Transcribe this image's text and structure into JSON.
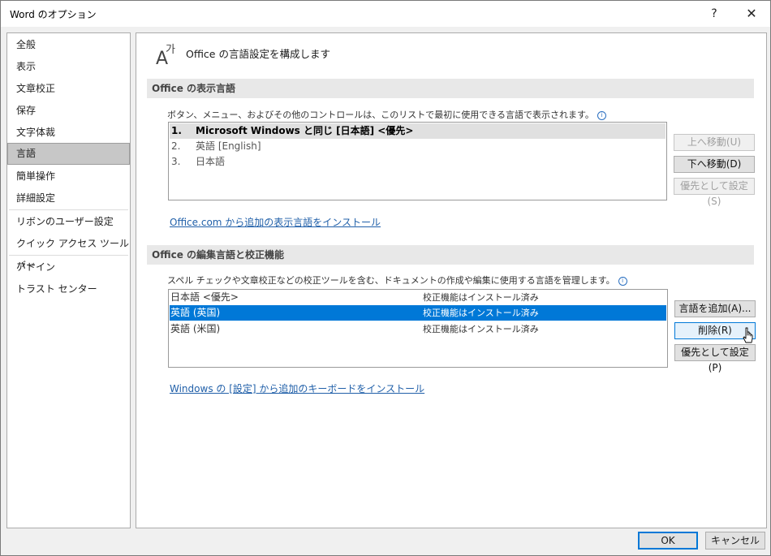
{
  "window": {
    "title": "Word のオプション",
    "help_label": "?",
    "close_label": "✕"
  },
  "sidebar": {
    "items": [
      {
        "label": "全般"
      },
      {
        "label": "表示"
      },
      {
        "label": "文章校正"
      },
      {
        "label": "保存"
      },
      {
        "label": "文字体裁"
      },
      {
        "label": "言語",
        "selected": true
      },
      {
        "label": "簡単操作"
      },
      {
        "label": "詳細設定"
      },
      {
        "label": "リボンのユーザー設定"
      },
      {
        "label": "クイック アクセス ツール バー"
      },
      {
        "label": "アドイン"
      },
      {
        "label": "トラスト センター"
      }
    ]
  },
  "header": {
    "icon": "language-icon",
    "text": "Office の言語設定を構成します"
  },
  "display_section": {
    "title": "Office の表示言語",
    "description": "ボタン、メニュー、およびその他のコントロールは、このリストで最初に使用できる言語で表示されます。",
    "languages": [
      {
        "num": "1.",
        "name": "Microsoft Windows と同じ [日本語] <優先>",
        "selected": true
      },
      {
        "num": "2.",
        "name": "英語 [English]"
      },
      {
        "num": "3.",
        "name": "日本語"
      }
    ],
    "buttons": {
      "move_up": "上へ移動(U)",
      "move_down": "下へ移動(D)",
      "set_preferred": "優先として設定(S)"
    },
    "link": "Office.com から追加の表示言語をインストール"
  },
  "editing_section": {
    "title": "Office の編集言語と校正機能",
    "description": "スペル チェックや文章校正などの校正ツールを含む、ドキュメントの作成や編集に使用する言語を管理します。",
    "languages": [
      {
        "name": "日本語 <優先>",
        "status": "校正機能はインストール済み"
      },
      {
        "name": "英語 (英国)",
        "status": "校正機能はインストール済み",
        "selected": true
      },
      {
        "name": "英語 (米国)",
        "status": "校正機能はインストール済み"
      }
    ],
    "buttons": {
      "add": "言語を追加(A)...",
      "remove": "削除(R)",
      "set_preferred": "優先として設定(P)"
    },
    "link": "Windows の [設定] から追加のキーボードをインストール"
  },
  "footer": {
    "ok": "OK",
    "cancel": "キャンセル"
  },
  "colors": {
    "selection_blue": "#0078d7",
    "link_blue": "#2160a9"
  }
}
